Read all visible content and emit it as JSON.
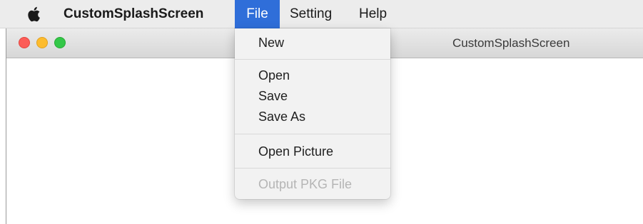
{
  "menubar": {
    "apple_icon": "apple-logo-icon",
    "app_name": "CustomSplashScreen",
    "menus": [
      {
        "label": "File",
        "active": true
      },
      {
        "label": "Setting",
        "active": false
      },
      {
        "label": "Help",
        "active": false
      }
    ],
    "active_color": "#2f6ed9"
  },
  "window": {
    "title": "CustomSplashScreen",
    "traffic_lights": {
      "close": "#fc5c57",
      "minimize": "#fdbc2e",
      "zoom": "#33c748"
    }
  },
  "file_menu": {
    "items": [
      {
        "label": "New",
        "enabled": true
      },
      {
        "label": "Open",
        "enabled": true
      },
      {
        "label": "Save",
        "enabled": true
      },
      {
        "label": "Save As",
        "enabled": true
      },
      {
        "label": "Open Picture",
        "enabled": true
      },
      {
        "label": "Output PKG File",
        "enabled": false
      }
    ]
  }
}
